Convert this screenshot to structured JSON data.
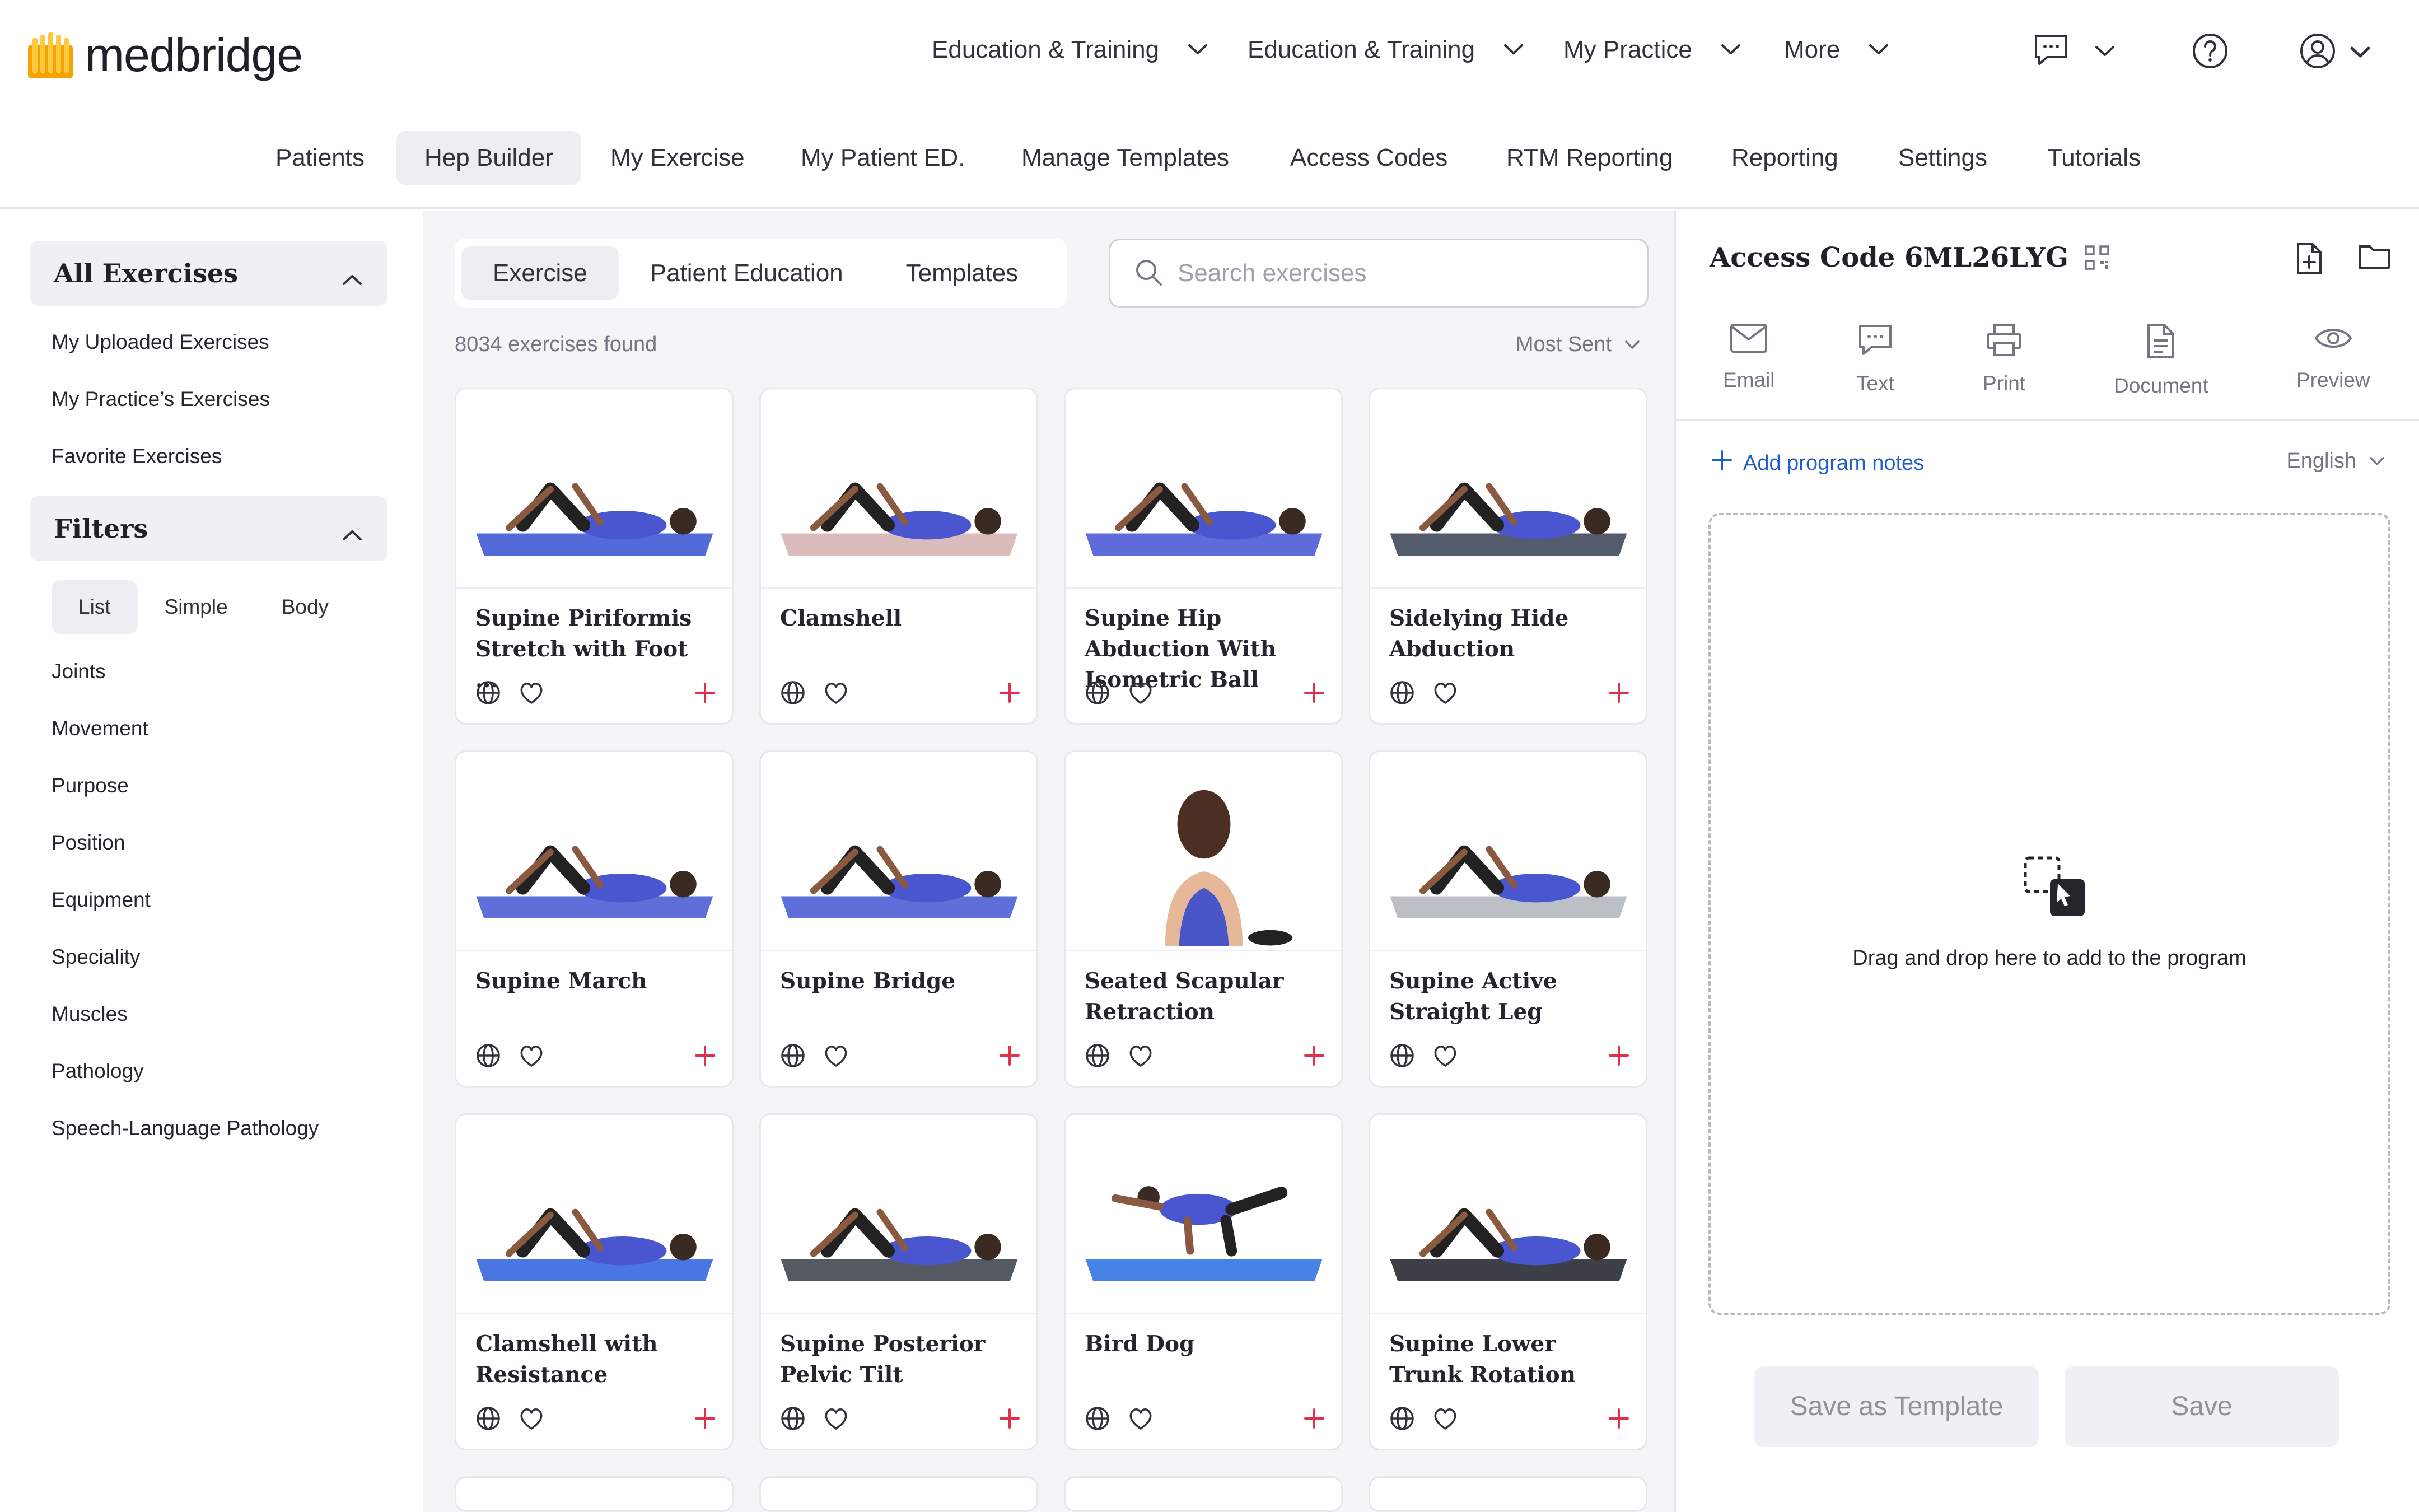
{
  "app": {
    "brand": "medbridge",
    "brand_color": "#f5a300"
  },
  "topnav": {
    "items": [
      {
        "label": "Education & Training"
      },
      {
        "label": "Education & Training"
      },
      {
        "label": "My Practice"
      },
      {
        "label": "More"
      }
    ],
    "icons": [
      "chat-icon",
      "help-icon",
      "account-icon"
    ]
  },
  "subnav": {
    "items": [
      {
        "label": "Patients"
      },
      {
        "label": "Hep Builder",
        "active": true
      },
      {
        "label": "My Exercise"
      },
      {
        "label": "My Patient ED."
      },
      {
        "label": "Manage Templates"
      },
      {
        "label": "Access Codes"
      },
      {
        "label": "RTM Reporting"
      },
      {
        "label": "Reporting"
      },
      {
        "label": "Settings"
      },
      {
        "label": "Tutorials"
      }
    ]
  },
  "sidebar": {
    "all_exercises": "All Exercises",
    "links": [
      "My Uploaded Exercises",
      "My Practice’s Exercises",
      "Favorite Exercises"
    ],
    "filters": "Filters",
    "view_modes": [
      {
        "label": "List",
        "active": true
      },
      {
        "label": "Simple"
      },
      {
        "label": "Body"
      }
    ],
    "filter_items": [
      "Joints",
      "Movement",
      "Purpose",
      "Position",
      "Equipment",
      "Speciality",
      "Muscles",
      "Pathology",
      "Speech-Language Pathology"
    ]
  },
  "center": {
    "tabs": [
      {
        "label": "Exercise",
        "active": true
      },
      {
        "label": "Patient Education"
      },
      {
        "label": "Templates"
      }
    ],
    "search_placeholder": "Search exercises",
    "found": "8034 exercises found",
    "sort": "Most Sent",
    "exercises": [
      {
        "title": "Supine Piriformis Stretch with Foot ...",
        "mat": "#4a63d6"
      },
      {
        "title": "Clamshell",
        "mat": "#d8b8b8"
      },
      {
        "title": "Supine Hip Abduction With Isometric Ball",
        "mat": "#5563d6"
      },
      {
        "title": "Sidelying Hide Abduction",
        "mat": "#4b5364"
      },
      {
        "title": "Supine March",
        "mat": "#5567d8"
      },
      {
        "title": "Supine Bridge",
        "mat": "#5567d8"
      },
      {
        "title": "Seated Scapular Retraction",
        "mat": "#ffffff"
      },
      {
        "title": "Supine Active Straight Leg",
        "mat": "#b9bcc4"
      },
      {
        "title": "Clamshell with Resistance",
        "mat": "#3f6fe0"
      },
      {
        "title": "Supine Posterior Pelvic Tilt",
        "mat": "#4c5058"
      },
      {
        "title": "Bird Dog",
        "mat": "#3d7be6"
      },
      {
        "title": "Supine Lower Trunk Rotation",
        "mat": "#33363d"
      }
    ]
  },
  "program": {
    "access_code": "Access Code 6ML26LYG",
    "share": [
      {
        "label": "Email",
        "icon": "mail-icon"
      },
      {
        "label": "Text",
        "icon": "text-icon"
      },
      {
        "label": "Print",
        "icon": "print-icon"
      },
      {
        "label": "Document",
        "icon": "document-icon"
      },
      {
        "label": "Preview",
        "icon": "eye-icon"
      }
    ],
    "add_notes": "Add program notes",
    "language": "English",
    "drop_text": "Drag and drop here to add to the program",
    "save_template": "Save as Template",
    "save": "Save"
  }
}
